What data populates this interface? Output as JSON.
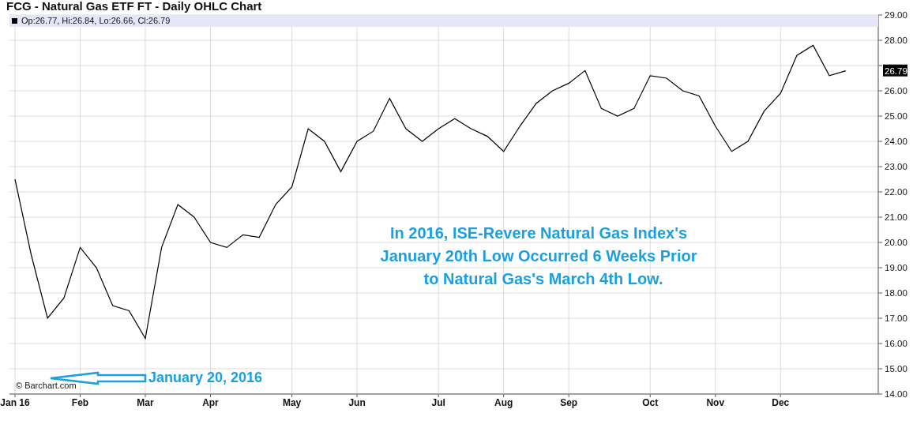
{
  "chart_data": {
    "type": "line",
    "title": "FCG - Natural Gas ETF FT - Daily OHLC Chart",
    "categories": [
      "Jan 16",
      null,
      null,
      null,
      "Feb",
      null,
      null,
      null,
      "Mar",
      null,
      null,
      null,
      "Apr",
      null,
      null,
      null,
      null,
      "May",
      null,
      null,
      null,
      "Jun",
      null,
      null,
      null,
      null,
      "Jul",
      null,
      null,
      null,
      "Aug",
      null,
      null,
      null,
      "Sep",
      null,
      null,
      null,
      null,
      "Oct",
      null,
      null,
      null,
      "Nov",
      null,
      null,
      null,
      "Dec",
      null,
      null,
      null,
      null,
      null
    ],
    "series": [
      {
        "color": "#000000",
        "values": [
          22.5,
          19.5,
          17.0,
          17.8,
          19.8,
          19.0,
          17.5,
          17.3,
          16.2,
          19.8,
          21.5,
          21.0,
          20.0,
          19.8,
          20.3,
          20.2,
          21.5,
          22.2,
          24.5,
          24.0,
          22.8,
          24.0,
          24.4,
          25.7,
          24.5,
          24.0,
          24.5,
          24.9,
          24.5,
          24.2,
          23.6,
          24.6,
          25.5,
          26.0,
          26.3,
          26.8,
          25.3,
          25.0,
          25.3,
          26.6,
          26.5,
          26.0,
          25.8,
          24.6,
          23.6,
          24.0,
          25.2,
          25.9,
          27.4,
          27.8,
          26.6,
          26.79,
          null
        ]
      }
    ],
    "ylim": [
      14,
      29
    ],
    "grid": true,
    "yticks": [
      {
        "value": 14,
        "label": "14.00"
      },
      {
        "value": 15,
        "label": "15.00"
      },
      {
        "value": 16,
        "label": "16.00"
      },
      {
        "value": 17,
        "label": "17.00"
      },
      {
        "value": 18,
        "label": "18.00"
      },
      {
        "value": 19,
        "label": "19.00"
      },
      {
        "value": 20,
        "label": "20.00"
      },
      {
        "value": 21,
        "label": "21.00"
      },
      {
        "value": 22,
        "label": "22.00"
      },
      {
        "value": 23,
        "label": "23.00"
      },
      {
        "value": 24,
        "label": "24.00"
      },
      {
        "value": 25,
        "label": "25.00"
      },
      {
        "value": 26,
        "label": "26.00"
      },
      {
        "value": 28,
        "label": "28.00"
      },
      {
        "value": 29,
        "label": "29.00"
      }
    ]
  },
  "legend": "Op:26.77, Hi:26.84, Lo:26.66, Cl:26.79",
  "last_price": "26.79",
  "note": {
    "color": "#1a9fe0",
    "lines": [
      "In 2016, ISE-Revere Natural Gas Index's",
      "January 20th Low Occurred 6 Weeks Prior",
      "to Natural Gas's March 4th Low."
    ]
  },
  "pointer": {
    "color": "#1a9fe0",
    "label": "January 20, 2016"
  },
  "credit": "© Barchart.com"
}
